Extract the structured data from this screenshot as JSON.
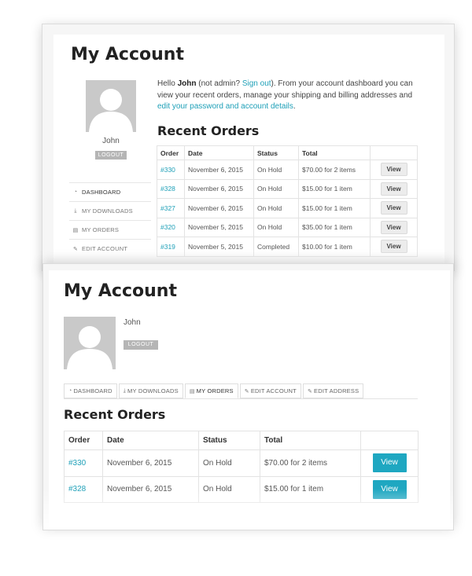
{
  "colors": {
    "link": "#1fa0b8",
    "view_button_primary": "#1fa7c1",
    "avatar_bg": "#c9c9c9"
  },
  "panel1": {
    "title": "My Account",
    "username": "John",
    "logout_label": "LOGOUT",
    "nav": [
      {
        "label": "DASHBOARD",
        "icon": "dashboard-icon",
        "glyph": "◔"
      },
      {
        "label": "MY DOWNLOADS",
        "icon": "download-icon",
        "glyph": "⤓"
      },
      {
        "label": "MY ORDERS",
        "icon": "document-icon",
        "glyph": "▤"
      },
      {
        "label": "EDIT ACCOUNT",
        "icon": "edit-icon",
        "glyph": "✎"
      }
    ],
    "intro": {
      "hello": "Hello ",
      "name": "John",
      "not_admin": " (not admin? ",
      "sign_out": "Sign out",
      "rest": "). From your account dashboard you can view your recent orders, manage your shipping and billing addresses and ",
      "edit_link": "edit your password and account details",
      "end": "."
    },
    "orders_heading": "Recent Orders",
    "columns": [
      "Order",
      "Date",
      "Status",
      "Total",
      ""
    ],
    "rows": [
      {
        "order": "#330",
        "date": "November 6, 2015",
        "status": "On Hold",
        "total": "$70.00 for 2 items"
      },
      {
        "order": "#328",
        "date": "November 6, 2015",
        "status": "On Hold",
        "total": "$15.00 for 1 item"
      },
      {
        "order": "#327",
        "date": "November 6, 2015",
        "status": "On Hold",
        "total": "$15.00 for 1 item"
      },
      {
        "order": "#320",
        "date": "November 5, 2015",
        "status": "On Hold",
        "total": "$35.00 for 1 item"
      },
      {
        "order": "#319",
        "date": "November 5, 2015",
        "status": "Completed",
        "total": "$10.00 for 1 item"
      }
    ],
    "view_label": "View"
  },
  "panel2": {
    "title": "My Account",
    "username": "John",
    "logout_label": "LOGOUT",
    "tabs": [
      {
        "label": "DASHBOARD",
        "icon": "dashboard-icon",
        "glyph": "◔"
      },
      {
        "label": "MY DOWNLOADS",
        "icon": "download-icon",
        "glyph": "⤓"
      },
      {
        "label": "MY ORDERS",
        "icon": "document-icon",
        "glyph": "▤"
      },
      {
        "label": "EDIT ACCOUNT",
        "icon": "edit-icon",
        "glyph": "✎"
      },
      {
        "label": "EDIT ADDRESS",
        "icon": "edit-icon",
        "glyph": "✎"
      }
    ],
    "orders_heading": "Recent Orders",
    "columns": [
      "Order",
      "Date",
      "Status",
      "Total",
      ""
    ],
    "rows": [
      {
        "order": "#330",
        "date": "November 6, 2015",
        "status": "On Hold",
        "total": "$70.00 for 2 items"
      },
      {
        "order": "#328",
        "date": "November 6, 2015",
        "status": "On Hold",
        "total": "$15.00 for 1 item"
      }
    ],
    "view_label": "View"
  }
}
